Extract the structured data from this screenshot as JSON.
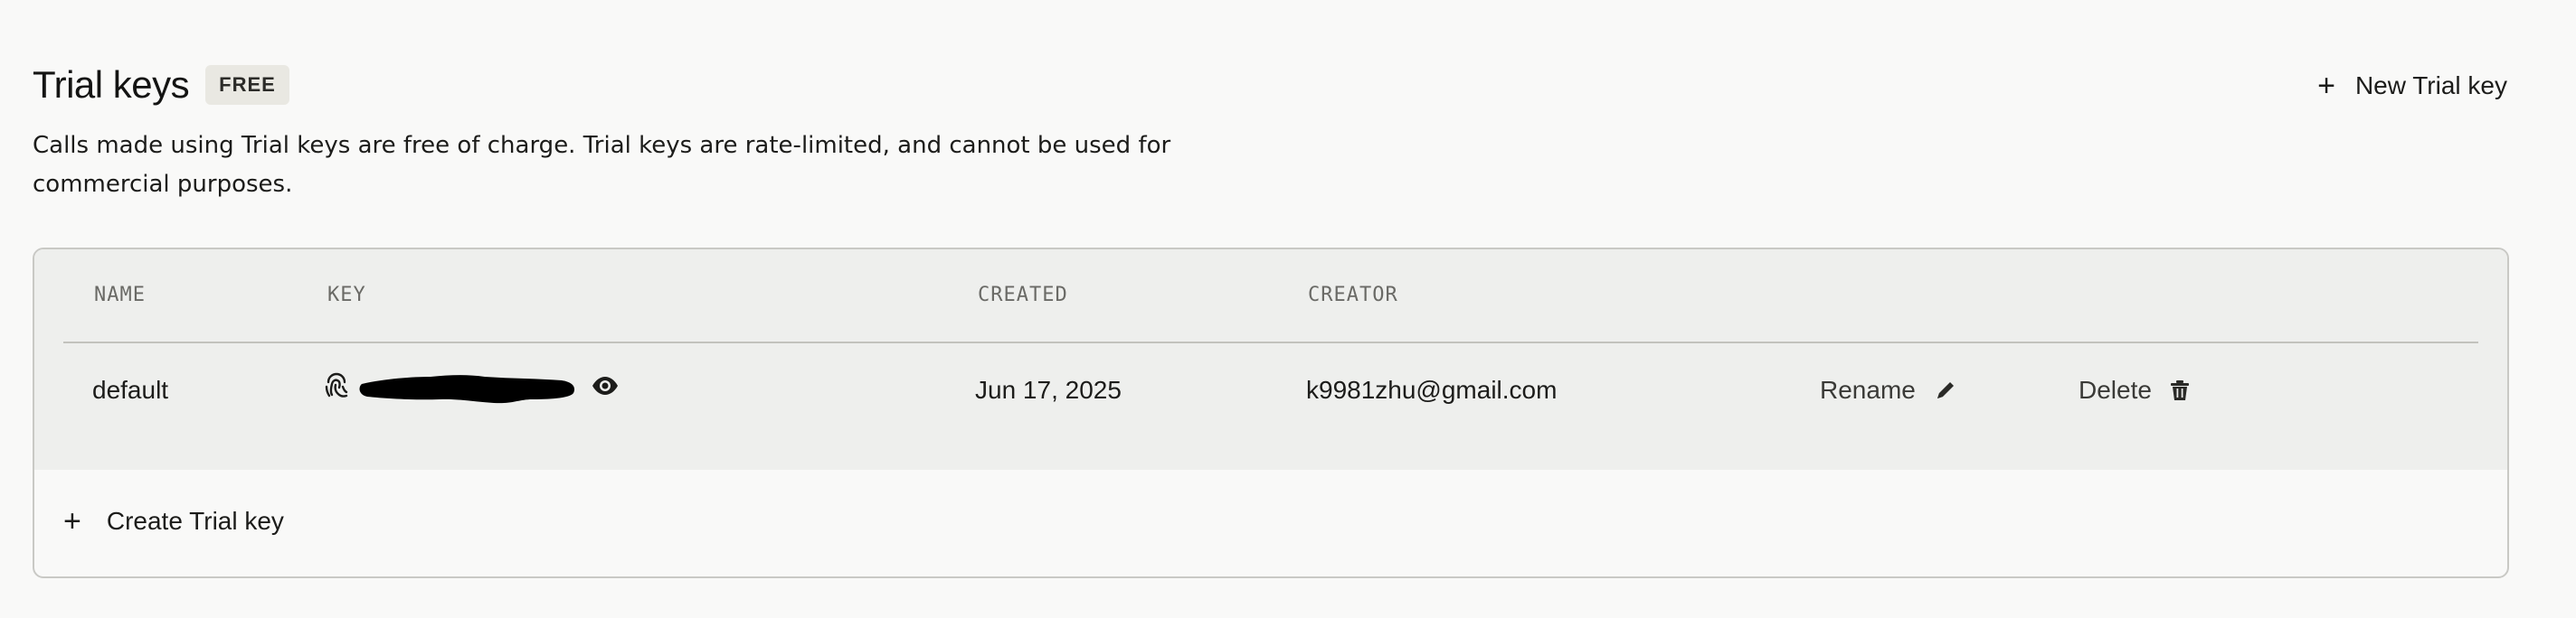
{
  "section": {
    "title": "Trial keys",
    "badge": "FREE",
    "new_key_label": "New Trial key",
    "description": "Calls made using Trial keys are free of charge. Trial keys are rate-limited, and cannot be used for commercial purposes."
  },
  "table": {
    "columns": [
      "NAME",
      "KEY",
      "CREATED",
      "CREATOR"
    ],
    "rows": [
      {
        "name": "default",
        "created": "Jun 17, 2025",
        "creator": "k9981zhu@gmail.com",
        "rename_label": "Rename",
        "delete_label": "Delete"
      }
    ],
    "create_label": "Create Trial key"
  },
  "icons": {
    "new_key": "plus-icon",
    "key": "fingerprint-icon",
    "reveal": "eye-icon",
    "rename": "pencil-icon",
    "delete": "trash-icon",
    "create": "plus-icon"
  }
}
